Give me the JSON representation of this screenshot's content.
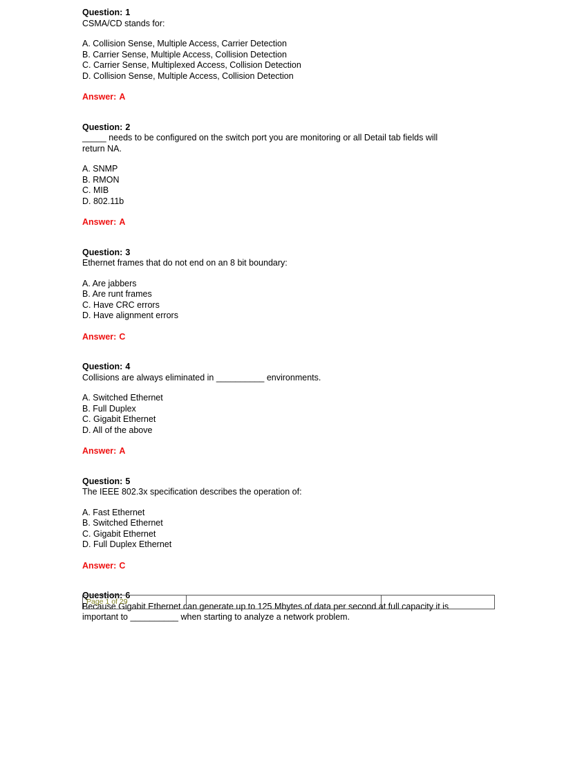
{
  "document": {
    "page_label": "Page 1 of 29",
    "answer_prefix": "Answer:",
    "question_prefix": "Question:",
    "accent_answer_color": "#ee1111",
    "page_label_color": "#7f7f1f",
    "border_color": "#555555"
  },
  "questions": [
    {
      "number": "1",
      "stem": "CSMA/CD stands for:",
      "stem_line2": "",
      "options": [
        "A. Collision Sense, Multiple Access, Carrier  Detection",
        "B. Carrier  Sense, Multiple Access, Collision Detection",
        "C. Carrier  Sense, Multiplexed Access, Collision Detection",
        "D. Collision Sense, Multiple Access, Collision Detection"
      ],
      "answer": "A"
    },
    {
      "number": "2",
      "stem": "_____ needs to be configured on the switch port you are  monitoring or all Detail tab fields will",
      "stem_line2": "return NA.",
      "options": [
        "A. SNMP",
        "B. RMON",
        "C. MIB",
        "D. 802.11b"
      ],
      "answer": "A"
    },
    {
      "number": "3",
      "stem": "Ethernet  frames that do not end on an 8 bit boundary:",
      "stem_line2": "",
      "options": [
        "A. Are jabbers",
        "B. Are runt  frames",
        "C. Have  CRC  errors",
        "D. Have  alignment errors"
      ],
      "answer": "C"
    },
    {
      "number": "4",
      "stem": "Collisions are always  eliminated in  __________   environments.",
      "stem_line2": "",
      "options": [
        "A. Switched Ethernet",
        "B. Full Duplex",
        "C. Gigabit Ethernet",
        "D. All of the above"
      ],
      "answer": "A"
    },
    {
      "number": "5",
      "stem": "The IEEE 802.3x  specification describes the operation of:",
      "stem_line2": "",
      "options": [
        "A. Fast Ethernet",
        "B. Switched Ethernet",
        "C. Gigabit Ethernet",
        "D. Full Duplex Ethernet"
      ],
      "answer": "C"
    },
    {
      "number": "6",
      "stem": "Because Gigabit Ethernet can generate  up to 125 Mbytes of data per second at full  capacity it is",
      "stem_line2": "important to __________   when starting to analyze a network problem.",
      "options": [],
      "answer": ""
    }
  ]
}
